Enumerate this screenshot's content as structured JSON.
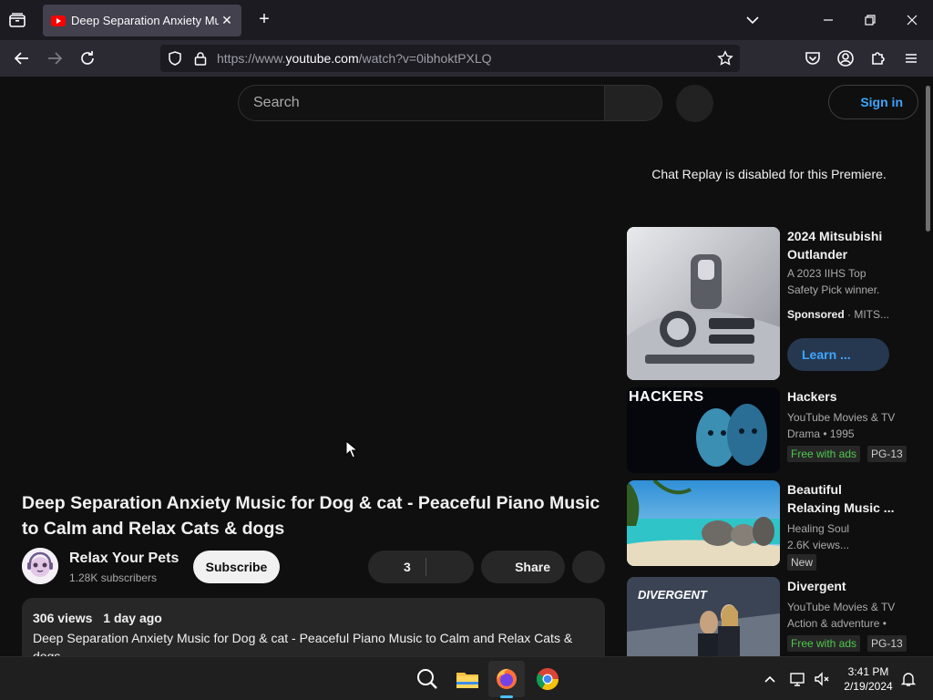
{
  "browser": {
    "tab_title": "Deep Separation Anxiety Music for Dog & cat - Peaceful Piano Music",
    "url_prefix": "https://www.",
    "url_domain": "youtube.com",
    "url_path": "/watch?v=0ibhoktPXLQ"
  },
  "header": {
    "search_placeholder": "Search",
    "signin_label": "Sign in"
  },
  "chat": {
    "replay_disabled": "Chat Replay is disabled for this Premiere."
  },
  "video": {
    "title": "Deep Separation Anxiety Music for Dog & cat - Peaceful Piano Music to Calm and Relax Cats & dogs",
    "channel_name": "Relax Your Pets",
    "subscribers": "1.28K subscribers",
    "subscribe_label": "Subscribe",
    "like_count": "3",
    "share_label": "Share",
    "views": "306 views",
    "age": "1 day ago",
    "description": "Deep Separation Anxiety Music for Dog & cat - Peaceful Piano Music to Calm and Relax Cats & dogs"
  },
  "sidebar": {
    "ad": {
      "title": "2024 Mitsubishi Outlander",
      "desc": "A 2023 IIHS Top Safety Pick winner.",
      "sponsored": "Sponsored",
      "advertiser": "MITS...",
      "cta": "Learn ..."
    },
    "items": [
      {
        "title": "Hackers",
        "thumb_text": "HACKERS",
        "line1": "YouTube Movies & TV",
        "line2": "Drama • 1995",
        "badge1": "Free with ads",
        "badge2": "PG-13"
      },
      {
        "title": "Beautiful Relaxing Music ...",
        "line1": "Healing Soul",
        "line2": "2.6K views...",
        "badge1": "New"
      },
      {
        "title": "Divergent",
        "thumb_text": "DIVERGENT",
        "line1": "YouTube Movies & TV",
        "line2": "Action & adventure •",
        "badge1": "Free with ads",
        "badge2": "PG-13"
      }
    ]
  },
  "taskbar": {
    "time": "3:41 PM",
    "date": "2/19/2024"
  },
  "colors": {
    "page_bg": "#0f0f0f",
    "accent_blue": "#3ea6ff",
    "badge_green": "#4ec94e"
  }
}
